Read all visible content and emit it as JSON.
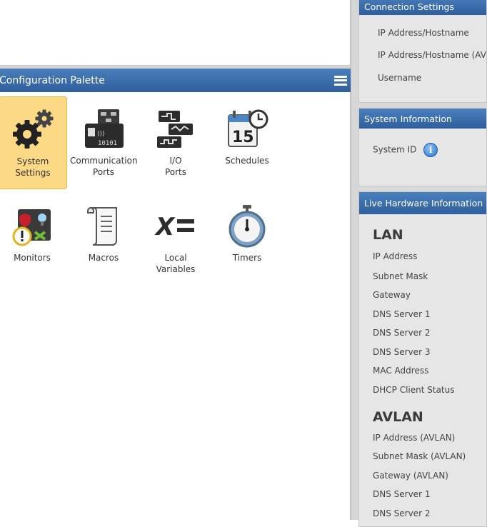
{
  "palette": {
    "title": "Configuration Palette",
    "tiles": [
      {
        "label1": "System",
        "label2": "Settings",
        "icon": "gears-icon"
      },
      {
        "label1": "Communication",
        "label2": "Ports",
        "icon": "network-port-icon"
      },
      {
        "label1": "I/O",
        "label2": "Ports",
        "icon": "io-ports-icon"
      },
      {
        "label1": "Schedules",
        "label2": "",
        "icon": "calendar-icon"
      },
      {
        "label1": "Monitors",
        "label2": "",
        "icon": "monitors-icon"
      },
      {
        "label1": "Macros",
        "label2": "",
        "icon": "scroll-icon"
      },
      {
        "label1": "Local",
        "label2": "Variables",
        "icon": "variables-icon"
      },
      {
        "label1": "Timers",
        "label2": "",
        "icon": "stopwatch-icon"
      }
    ]
  },
  "connection": {
    "title": "Connection Settings",
    "rows": [
      "IP Address/Hostname",
      "IP Address/Hostname (AV",
      "Username"
    ]
  },
  "system_info": {
    "title": "System Information",
    "system_id_label": "System ID"
  },
  "live_hw": {
    "title": "Live Hardware Information",
    "lan_title": "LAN",
    "lan_rows": [
      "IP Address",
      "Subnet Mask",
      "Gateway",
      "DNS Server 1",
      "DNS Server 2",
      "DNS Server 3",
      "MAC Address",
      "DHCP Client Status"
    ],
    "avlan_title": "AVLAN",
    "avlan_rows": [
      "IP Address (AVLAN)",
      "Subnet Mask (AVLAN)",
      "Gateway (AVLAN)",
      "DNS Server 1",
      "DNS Server 2"
    ]
  },
  "colors": {
    "header_blue": "#3a6aa9",
    "selected_tile": "#fbd985"
  }
}
